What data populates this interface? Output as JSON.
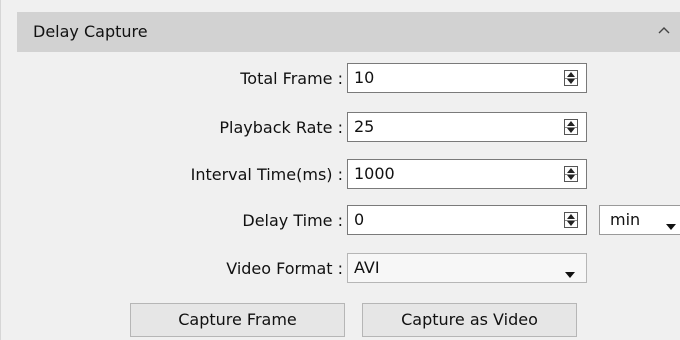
{
  "panel": {
    "title": "Delay Capture",
    "collapse_icon": "chevron-up-icon"
  },
  "fields": {
    "total_frame": {
      "label": "Total Frame :",
      "value": "10"
    },
    "playback_rate": {
      "label": "Playback Rate :",
      "value": "25"
    },
    "interval_time": {
      "label": "Interval Time(ms) :",
      "value": "1000"
    },
    "delay_time": {
      "label": "Delay Time :",
      "value": "0",
      "unit": "min"
    },
    "video_format": {
      "label": "Video Format :",
      "value": "AVI"
    }
  },
  "buttons": {
    "capture_frame": "Capture Frame",
    "capture_video": "Capture as Video"
  }
}
